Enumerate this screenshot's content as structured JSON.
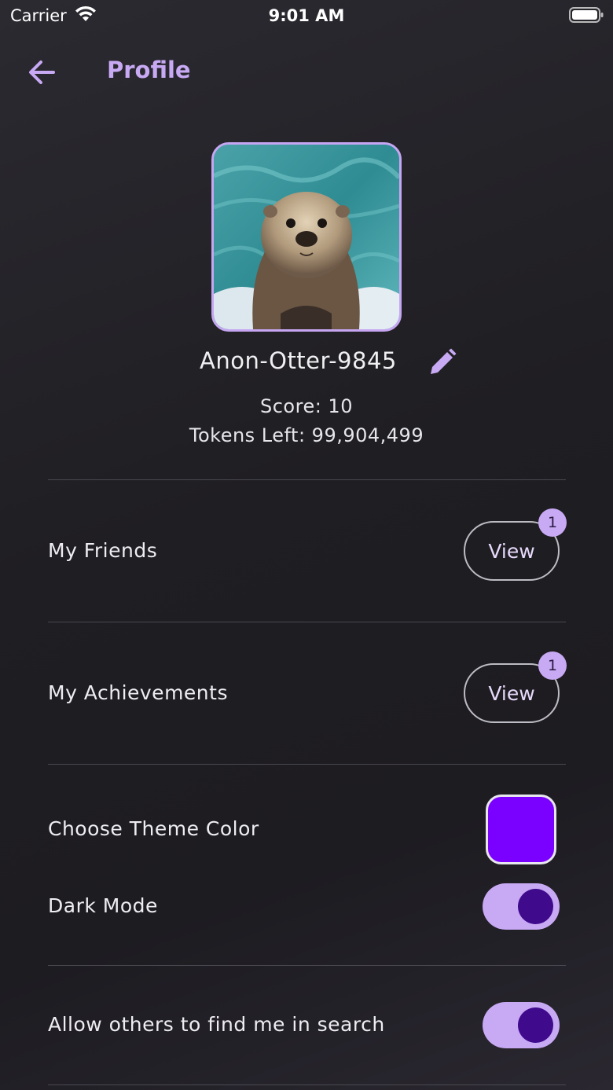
{
  "status_bar": {
    "carrier": "Carrier",
    "time": "9:01 AM"
  },
  "header": {
    "title": "Profile",
    "back_icon": "arrow-left-icon"
  },
  "profile": {
    "avatar_icon": "otter-avatar",
    "username": "Anon-Otter-9845",
    "edit_icon": "pencil-icon",
    "score_line": "Score:  10",
    "tokens_line": "Tokens Left:  99,904,499"
  },
  "friends": {
    "label": "My Friends",
    "button": "View",
    "badge": "1"
  },
  "achievements": {
    "label": "My Achievements",
    "button": "View",
    "badge": "1"
  },
  "theme": {
    "label": "Choose Theme Color",
    "color": "#7a00ff"
  },
  "dark_mode": {
    "label": "Dark Mode",
    "enabled": true
  },
  "searchable": {
    "label": "Allow others to find me in search",
    "enabled": true
  },
  "colors": {
    "accent": "#c8a9f4",
    "knob": "#3f0a8c",
    "background": "#1f1e22"
  }
}
